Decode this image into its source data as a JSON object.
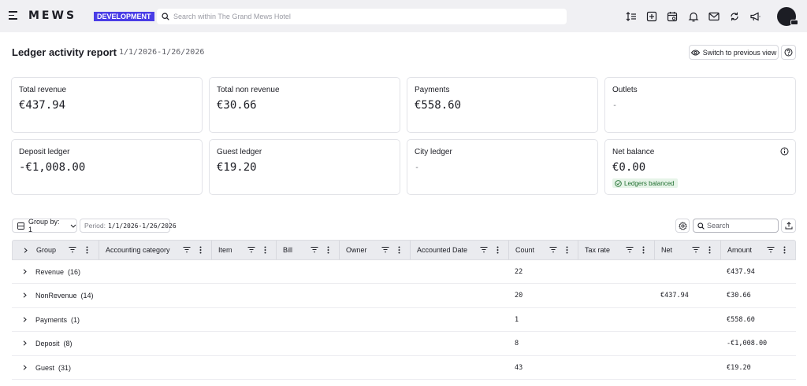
{
  "app": {
    "logo": "MEWS",
    "environment": "DEVELOPMENT",
    "search_placeholder": "Search within The Grand Mews Hotel"
  },
  "top_icons": [
    "sort-icon",
    "add-box-icon",
    "calendar-icon",
    "bell-icon",
    "mail-icon",
    "sync-icon",
    "megaphone-icon"
  ],
  "page": {
    "title": "Ledger activity report",
    "date_range": "1/1/2026-1/26/2026",
    "switch_label": "Switch to previous view"
  },
  "cards": [
    {
      "label": "Total revenue",
      "value": "€437.94"
    },
    {
      "label": "Total non revenue",
      "value": "€30.66"
    },
    {
      "label": "Payments",
      "value": "€558.60"
    },
    {
      "label": "Outlets",
      "value": "-"
    },
    {
      "label": "Deposit ledger",
      "value": "-€1,008.00"
    },
    {
      "label": "Guest ledger",
      "value": "€19.20"
    },
    {
      "label": "City ledger",
      "value": "-"
    },
    {
      "label": "Net balance",
      "value": "€0.00",
      "badge": "Ledgers balanced"
    }
  ],
  "toolbar": {
    "group_by_label": "Group by: 1",
    "period_label": "Period:",
    "period_value": "1/1/2026-1/26/2026",
    "search_placeholder": "Search"
  },
  "table": {
    "columns": [
      "Group",
      "Accounting category",
      "Item",
      "Bill",
      "Owner",
      "Accounted Date",
      "Count",
      "Tax rate",
      "Net",
      "Amount"
    ],
    "rows": [
      {
        "group": "Revenue",
        "count_label": "(16)",
        "count": "22",
        "net": "",
        "amount": "€437.94"
      },
      {
        "group": "NonRevenue",
        "count_label": "(14)",
        "count": "20",
        "net": "€437.94",
        "amount": "€30.66"
      },
      {
        "group": "Payments",
        "count_label": "(1)",
        "count": "1",
        "net": "",
        "amount": "€558.60"
      },
      {
        "group": "Deposit",
        "count_label": "(8)",
        "count": "8",
        "net": "",
        "amount": "-€1,008.00"
      },
      {
        "group": "Guest",
        "count_label": "(31)",
        "count": "43",
        "net": "",
        "amount": "€19.20"
      }
    ]
  }
}
